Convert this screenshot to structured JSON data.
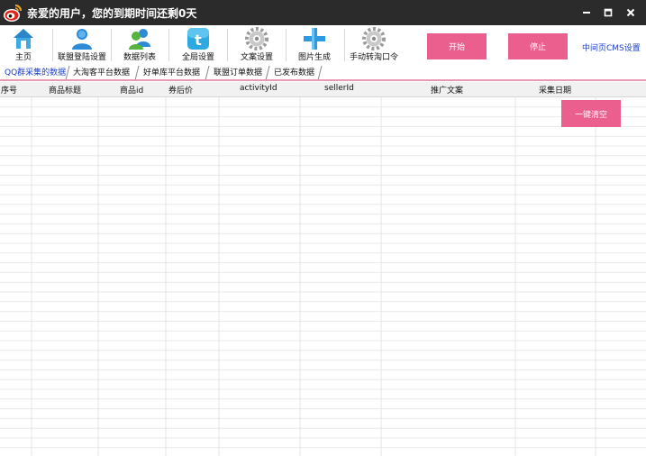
{
  "window": {
    "title": "亲爱的用户，您的到期时间还剩0天"
  },
  "toolbar": {
    "items": [
      {
        "label": "主页",
        "icon": "home-icon"
      },
      {
        "label": "联盟登陆设置",
        "icon": "user-icon"
      },
      {
        "label": "数据列表",
        "icon": "users-icon"
      },
      {
        "label": "全局设置",
        "icon": "twitter-icon"
      },
      {
        "label": "文案设置",
        "icon": "gear-icon"
      },
      {
        "label": "图片生成",
        "icon": "plus-icon"
      },
      {
        "label": "手动转淘口令",
        "icon": "gear-icon"
      }
    ],
    "start_label": "开始",
    "stop_label": "停止",
    "cms_label": "中间页CMS设置"
  },
  "tabs": [
    {
      "label": "QQ群采集的数据",
      "active": true
    },
    {
      "label": "大淘客平台数据",
      "active": false
    },
    {
      "label": "好单库平台数据",
      "active": false
    },
    {
      "label": "联盟订单数据",
      "active": false
    },
    {
      "label": "已发布数据",
      "active": false
    }
  ],
  "table": {
    "columns": [
      "序号",
      "商品标题",
      "商品id",
      "券后价",
      "activityId",
      "sellerId",
      "推广文案",
      "采集日期"
    ],
    "rows": []
  },
  "actions": {
    "clear_label": "一键清空"
  },
  "colors": {
    "titlebar": "#2b2b2b",
    "accent": "#eb5f8e",
    "link": "#1a3fc8",
    "tab_underline": "#e79ab3"
  }
}
